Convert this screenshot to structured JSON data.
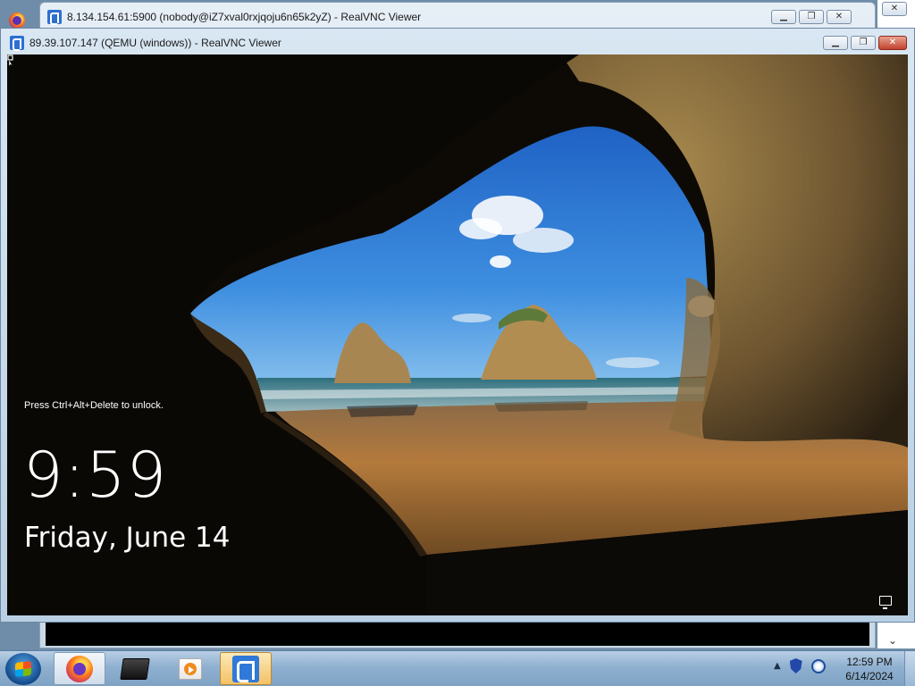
{
  "outer_window": {
    "title": "8.134.154.61:5900 (nobody@iZ7xval0rxjqoju6n65k2yZ) - RealVNC Viewer",
    "controls": {
      "minimize": "▁",
      "restore": "❐",
      "close": "✕"
    }
  },
  "inner_window": {
    "title": "89.39.107.147 (QEMU (windows)) - RealVNC Viewer",
    "controls": {
      "minimize": "▁",
      "restore": "❐",
      "close": "✕"
    }
  },
  "lock_screen": {
    "hint": "Press Ctrl+Alt+Delete to unlock.",
    "time": "9:59",
    "date": "Friday, June 14"
  },
  "right_strip": {
    "scroll_down": "⌄"
  },
  "taskbar": {
    "tray_chevron": "▲",
    "clock_time": "12:59 PM",
    "clock_date": "6/14/2024"
  },
  "colors": {
    "sky": "#2f7fd0",
    "sand": "#b47a3c",
    "rock": "#8a6a3c",
    "cave": "#0d0a06"
  },
  "icons": {
    "start": "windows-orb-icon",
    "firefox": "firefox-icon",
    "terminal": "terminal-icon",
    "media": "media-player-icon",
    "vnc": "realvnc-icon",
    "tray_shield": "shield-icon",
    "tray_network": "network-globe-icon",
    "lock_network": "network-monitor-icon"
  }
}
